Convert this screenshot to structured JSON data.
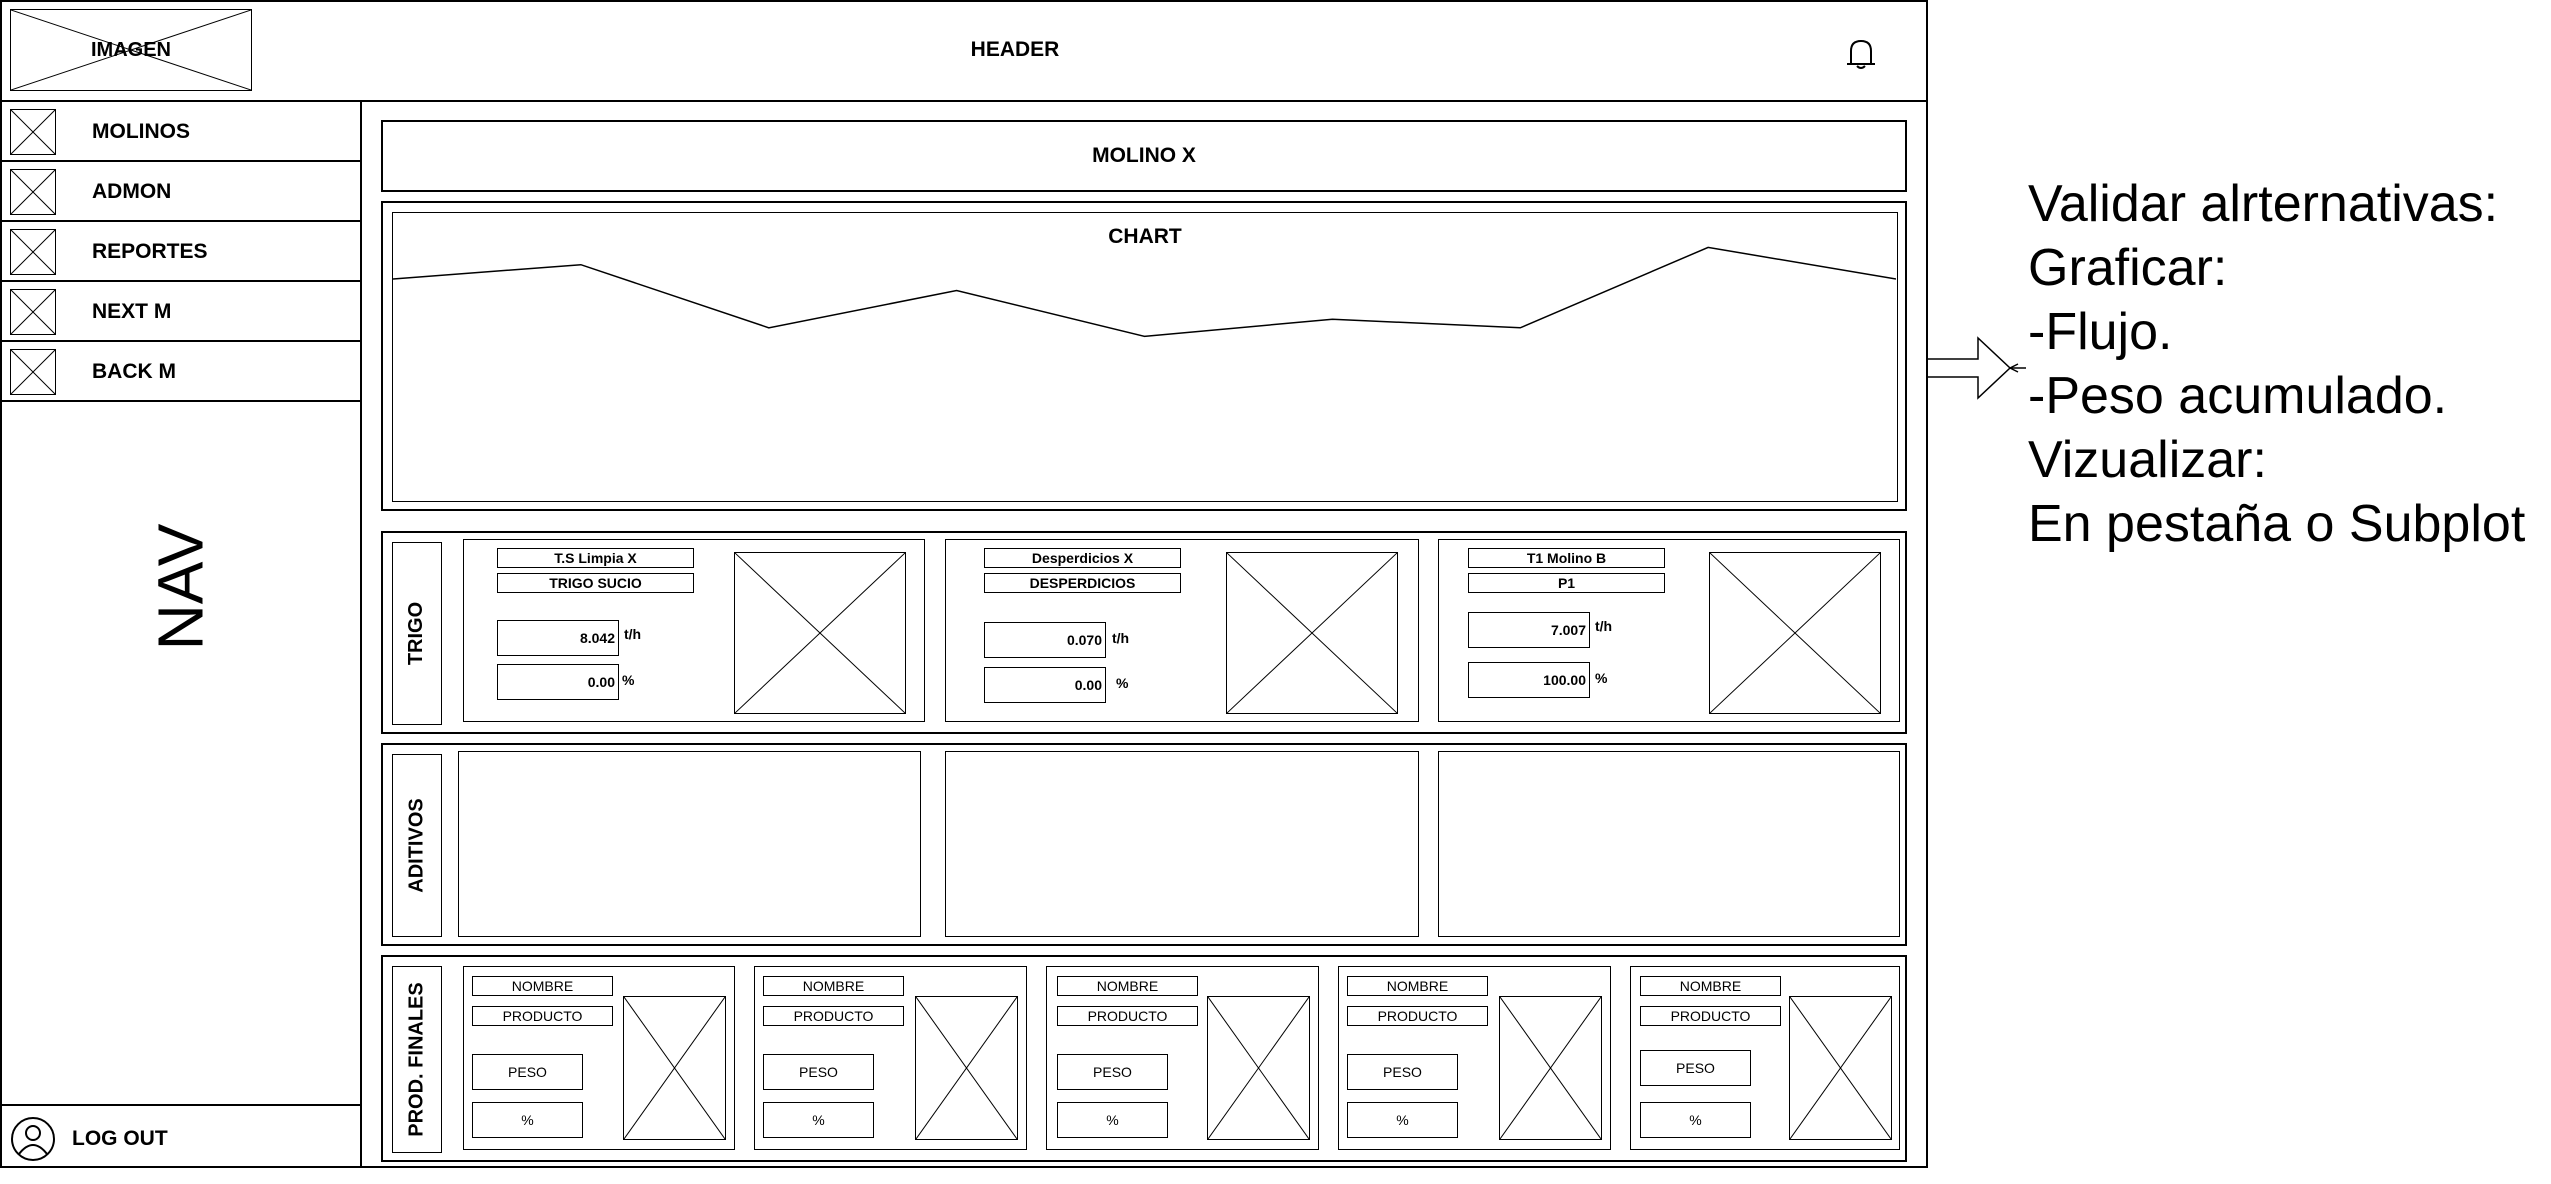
{
  "header": {
    "logo_label": "IMAGEN",
    "title": "HEADER",
    "notification_icon": "bell-icon"
  },
  "nav": {
    "items": [
      {
        "label": "MOLINOS",
        "icon": "image-placeholder-icon"
      },
      {
        "label": "ADMON",
        "icon": "image-placeholder-icon"
      },
      {
        "label": "REPORTES",
        "icon": "image-placeholder-icon"
      },
      {
        "label": "NEXT M",
        "icon": "image-placeholder-icon"
      },
      {
        "label": "BACK M",
        "icon": "image-placeholder-icon"
      }
    ],
    "watermark": "NAV",
    "logout": {
      "label": "LOG OUT",
      "icon": "user-icon"
    }
  },
  "main": {
    "title": "MOLINO X",
    "chart": {
      "label": "CHART"
    },
    "trigo": {
      "label": "TRIGO",
      "cards": [
        {
          "name": "T.S Limpia X",
          "product": "TRIGO SUCIO",
          "flow": "8.042",
          "flow_unit": "t/h",
          "percent": "0.00",
          "percent_unit": "%"
        },
        {
          "name": "Desperdicios X",
          "product": "DESPERDICIOS",
          "flow": "0.070",
          "flow_unit": "t/h",
          "percent": "0.00",
          "percent_unit": "%"
        },
        {
          "name": "T1 Molino B",
          "product": "P1",
          "flow": "7.007",
          "flow_unit": "t/h",
          "percent": "100.00",
          "percent_unit": "%"
        }
      ]
    },
    "aditivos": {
      "label": "ADITIVOS"
    },
    "prod_finales": {
      "label": "PROD. FINALES",
      "cards": [
        {
          "name": "NOMBRE",
          "product": "PRODUCTO",
          "weight": "PESO",
          "percent": "%"
        },
        {
          "name": "NOMBRE",
          "product": "PRODUCTO",
          "weight": "PESO",
          "percent": "%"
        },
        {
          "name": "NOMBRE",
          "product": "PRODUCTO",
          "weight": "PESO",
          "percent": "%"
        },
        {
          "name": "NOMBRE",
          "product": "PRODUCTO",
          "weight": "PESO",
          "percent": "%"
        },
        {
          "name": "NOMBRE",
          "product": "PRODUCTO",
          "weight": "PESO",
          "percent": "%"
        }
      ]
    }
  },
  "annotation": {
    "lines": [
      "Validar alrternativas:",
      "Graficar:",
      "-Flujo.",
      "-Peso acumulado.",
      "Vizualizar:",
      "En pestaña o Subplot"
    ]
  },
  "chart_data": {
    "type": "line",
    "title": "CHART",
    "x": [
      0,
      1,
      2,
      3,
      4,
      5,
      6,
      7,
      8
    ],
    "series": [
      {
        "values": [
          0.77,
          0.82,
          0.6,
          0.73,
          0.57,
          0.63,
          0.6,
          0.88,
          0.77
        ]
      }
    ],
    "ylim": [
      0,
      1
    ],
    "grid": false,
    "legend": "none"
  }
}
